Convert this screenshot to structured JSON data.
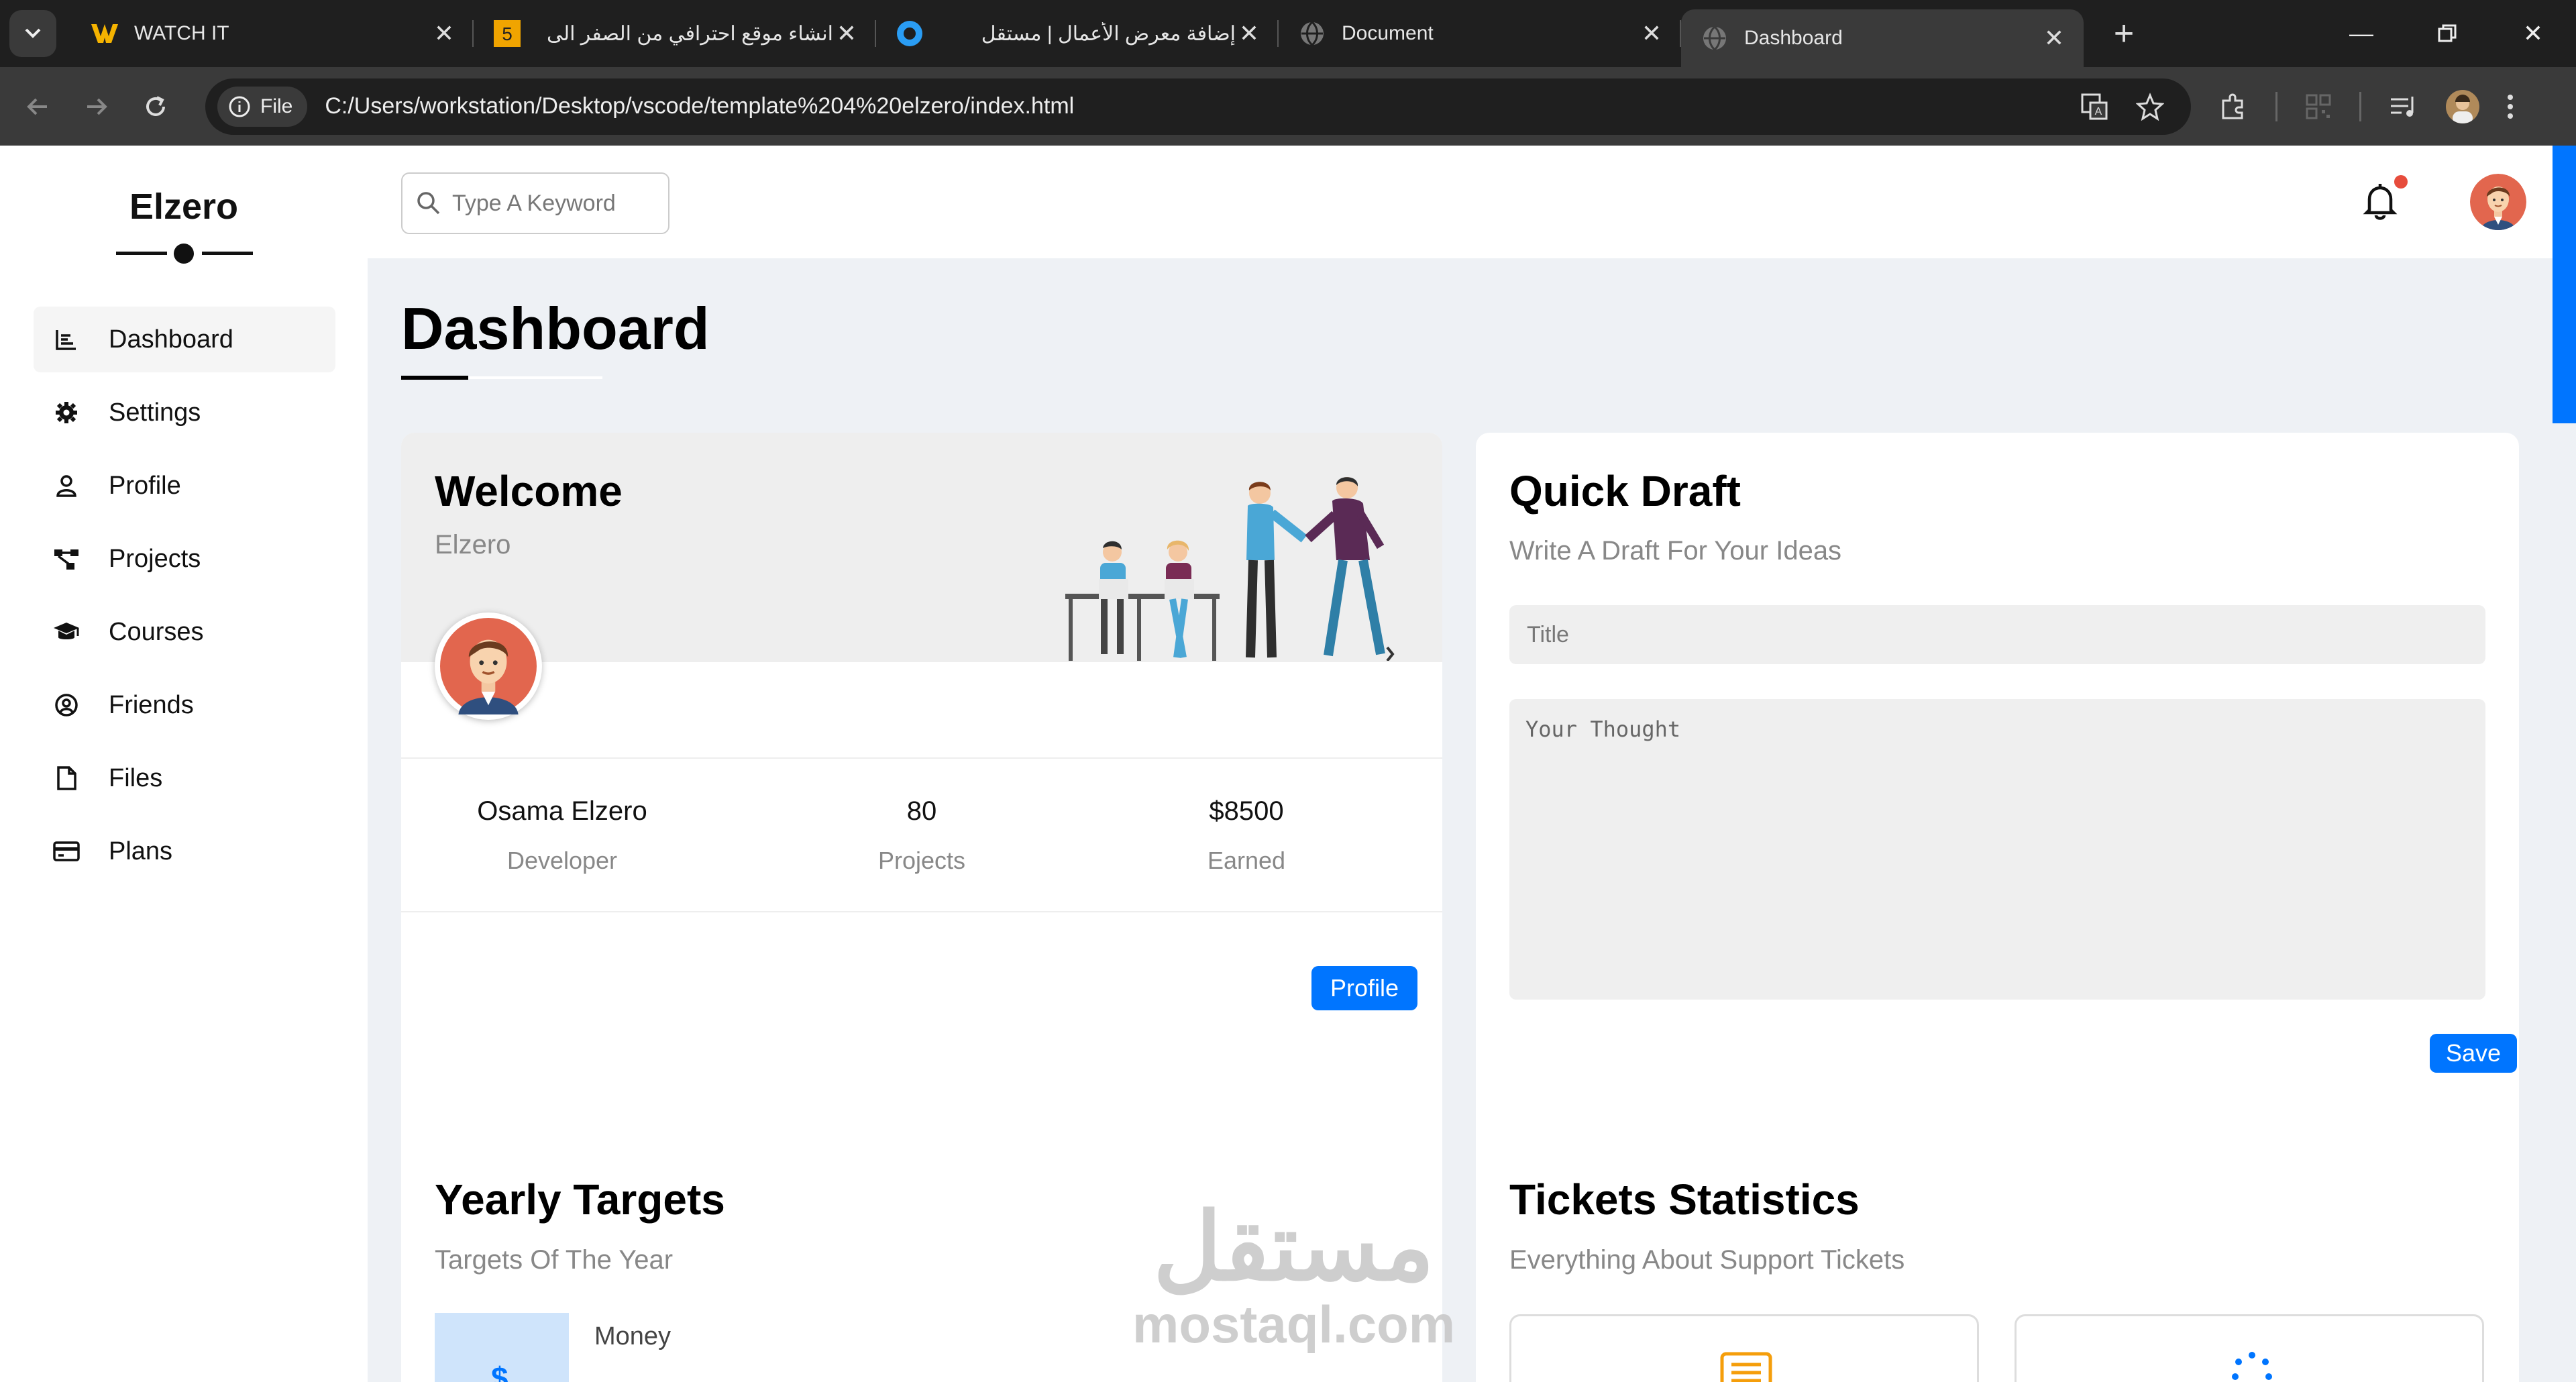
{
  "browser": {
    "tabs": [
      {
        "title": "WATCH IT",
        "icon": "watchit-favicon",
        "active": false
      },
      {
        "title": "انشاء موقع احترافي من الصفر الى",
        "icon": "number5-favicon",
        "active": false
      },
      {
        "title": "إضافة معرض الأعمال | مستقل",
        "icon": "mostaql-favicon",
        "active": false
      },
      {
        "title": "Document",
        "icon": "globe-favicon",
        "active": false
      },
      {
        "title": "Dashboard",
        "icon": "globe-favicon",
        "active": true
      }
    ],
    "address": {
      "chip_label": "File",
      "url": "C:/Users/workstation/Desktop/vscode/template%204%20elzero/index.html"
    }
  },
  "sidebar": {
    "brand": "Elzero",
    "items": [
      {
        "label": "Dashboard",
        "icon": "chart-bars-icon",
        "active": true
      },
      {
        "label": "Settings",
        "icon": "gear-icon",
        "active": false
      },
      {
        "label": "Profile",
        "icon": "user-icon",
        "active": false
      },
      {
        "label": "Projects",
        "icon": "diagram-icon",
        "active": false
      },
      {
        "label": "Courses",
        "icon": "graduation-cap-icon",
        "active": false
      },
      {
        "label": "Friends",
        "icon": "circle-user-icon",
        "active": false
      },
      {
        "label": "Files",
        "icon": "file-icon",
        "active": false
      },
      {
        "label": "Plans",
        "icon": "credit-card-icon",
        "active": false
      }
    ]
  },
  "header": {
    "search_placeholder": "Type A Keyword"
  },
  "page": {
    "title": "Dashboard"
  },
  "welcome": {
    "title": "Welcome",
    "subtitle": "Elzero",
    "stats": [
      {
        "value": "Osama Elzero",
        "label": "Developer"
      },
      {
        "value": "80",
        "label": "Projects"
      },
      {
        "value": "$8500",
        "label": "Earned"
      }
    ],
    "button_label": "Profile"
  },
  "draft": {
    "title": "Quick Draft",
    "subtitle": "Write A Draft For Your Ideas",
    "title_placeholder": "Title",
    "thought_placeholder": "Your Thought",
    "save_label": "Save"
  },
  "targets": {
    "title": "Yearly Targets",
    "subtitle": "Targets Of The Year",
    "money_label": "Money",
    "money_icon": "$"
  },
  "tickets": {
    "title": "Tickets Statistics",
    "subtitle": "Everything About Support Tickets"
  },
  "watermark": {
    "arabic": "مستقل",
    "latin": "mostaql.com"
  },
  "colors": {
    "accent": "#0075ff",
    "page_bg": "#eef1f5",
    "notification_dot": "#e74c3c"
  }
}
